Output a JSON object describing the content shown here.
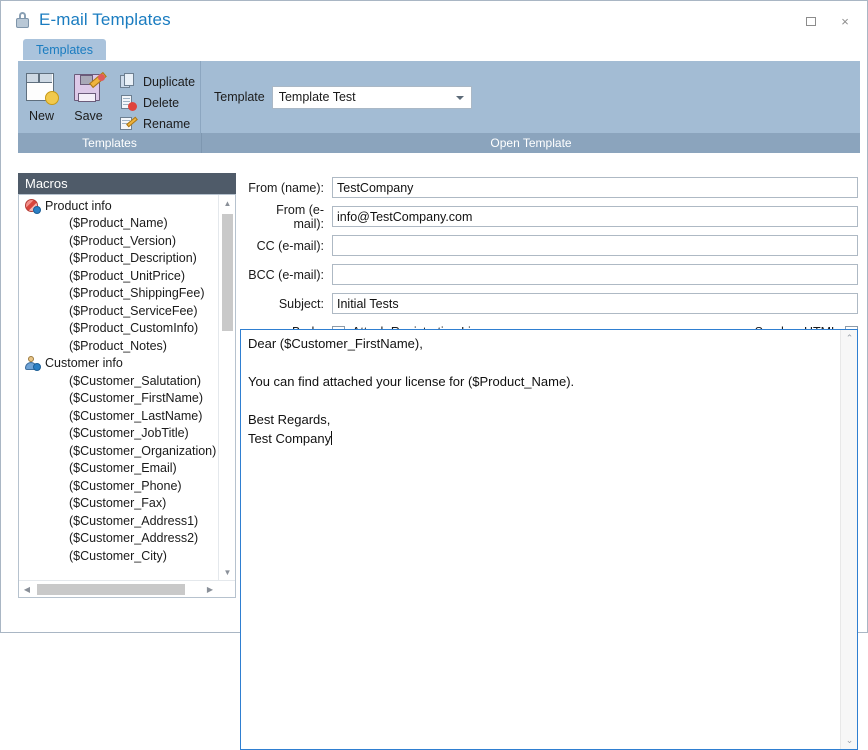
{
  "window": {
    "title": "E-mail Templates",
    "title_icon": "lock-icon",
    "controls": {
      "maximize": "maximize-icon",
      "close": "×"
    }
  },
  "ribbon": {
    "tabs": [
      {
        "label": "Templates",
        "active": true
      }
    ],
    "groups": [
      {
        "name": "Templates",
        "footer_label": "Templates",
        "large_buttons": [
          {
            "label": "New",
            "icon": "new-document-icon"
          },
          {
            "label": "Save",
            "icon": "save-floppy-icon"
          }
        ],
        "small_buttons": [
          {
            "label": "Duplicate",
            "icon": "duplicate-icon"
          },
          {
            "label": "Delete",
            "icon": "delete-icon"
          },
          {
            "label": "Rename",
            "icon": "rename-icon"
          }
        ]
      },
      {
        "name": "Open Template",
        "footer_label": "Open Template",
        "template_label": "Template",
        "template_value": "Template Test",
        "dropdown_icon": "chevron-down-icon"
      }
    ]
  },
  "macros": {
    "header": "Macros",
    "tree": [
      {
        "label": "Product info",
        "icon": "product-info-icon",
        "children": [
          "($Product_Name)",
          "($Product_Version)",
          "($Product_Description)",
          "($Product_UnitPrice)",
          "($Product_ShippingFee)",
          "($Product_ServiceFee)",
          "($Product_CustomInfo)",
          "($Product_Notes)"
        ]
      },
      {
        "label": "Customer info",
        "icon": "customer-info-icon",
        "children": [
          "($Customer_Salutation)",
          "($Customer_FirstName)",
          "($Customer_LastName)",
          "($Customer_JobTitle)",
          "($Customer_Organization)",
          "($Customer_Email)",
          "($Customer_Phone)",
          "($Customer_Fax)",
          "($Customer_Address1)",
          "($Customer_Address2)",
          "($Customer_City)"
        ]
      }
    ],
    "scroll_up_icon": "▲",
    "scroll_down_icon": "▼",
    "scroll_left_icon": "◀",
    "scroll_right_icon": "▶"
  },
  "form": {
    "fields": [
      {
        "label": "From (name):",
        "value": "TestCompany",
        "placeholder": ""
      },
      {
        "label": "From (e-mail):",
        "value": "info@TestCompany.com",
        "placeholder": ""
      },
      {
        "label": "CC (e-mail):",
        "value": "",
        "placeholder": ""
      },
      {
        "label": "BCC (e-mail):",
        "value": "",
        "placeholder": ""
      },
      {
        "label": "Subject:",
        "value": "Initial Tests",
        "placeholder": ""
      }
    ],
    "body_label": "Body:",
    "attach_license": {
      "label": "Attach Registration License",
      "checked": true
    },
    "send_as_html": {
      "label": "Send as HTML",
      "checked": false
    },
    "body_text": "Dear ($Customer_FirstName),\n\nYou can find attached your license for ($Product_Name).\n\nBest Regards,\nTest Company",
    "scroll_up_icon": "⌃",
    "scroll_down_icon": "⌄"
  },
  "colors": {
    "title_text": "#1a7cc0",
    "ribbon_bg": "#a3bcd4",
    "ribbon_footer": "#8ba4bd",
    "tab_active": "#aac3dc",
    "macros_header": "#4f5b69",
    "focus_border": "#2f7fd1"
  }
}
